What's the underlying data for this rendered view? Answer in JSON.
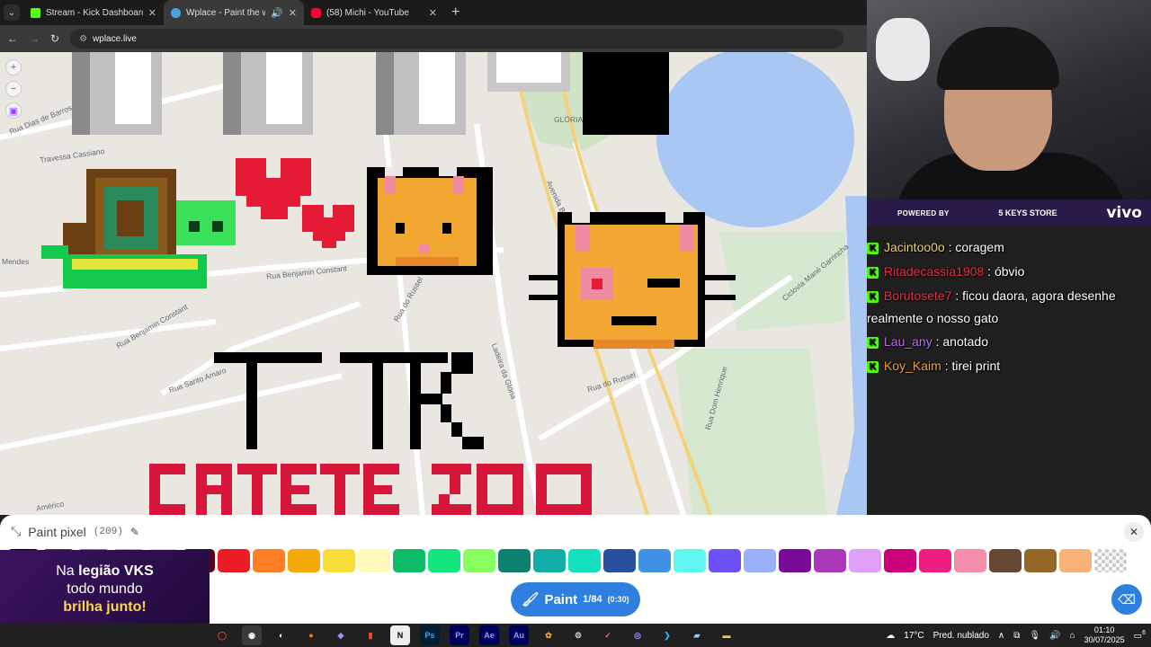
{
  "browser": {
    "tabs": [
      {
        "title": "Stream - Kick Dashboard",
        "color": "#53fc18",
        "active": false
      },
      {
        "title": "Wplace - Paint the world",
        "color": "#4aa3df",
        "active": true
      },
      {
        "title": "(58) Michi - YouTube",
        "color": "#ff0033",
        "active": false
      }
    ],
    "url": "wplace.live"
  },
  "map": {
    "streets": [
      "Rua Dias de Barros",
      "Travessa Cassiano",
      "Rua Benjamin Constant",
      "Rua Benjamin Constant",
      "Rua Santo Amaro",
      "Rua do Russel",
      "Rua do Russel",
      "Ladeira da Glória",
      "Rua Santo Amaro",
      "Avenida Beira Mar",
      "Ciclovia Mané Garrincha",
      "Rua Dom Henrique",
      "GLÓRIA",
      "Américo",
      "Mendes"
    ]
  },
  "stream": {
    "sponsor_label": "POWERED BY",
    "sponsor_logo": "5 KEYS STORE",
    "sponsor_brand": "vivo",
    "chat": [
      {
        "user": "Jacintoo0o",
        "color": "#f0d060",
        "msg": "coragem"
      },
      {
        "user": "Ritadecassia1908",
        "color": "#e8324a",
        "msg": "óbvio"
      },
      {
        "user": "Borutosete7",
        "color": "#e8324a",
        "msg": "ficou daora, agora desenhe"
      },
      {
        "user": "",
        "color": "#ffffff",
        "msg": "realmente o nosso gato"
      },
      {
        "user": "Lau_any",
        "color": "#b770f0",
        "msg": "anotado"
      },
      {
        "user": "Koy_Kaim",
        "color": "#f0a040",
        "msg": "tirei print"
      }
    ]
  },
  "panel": {
    "title": "Paint pixel",
    "count": "(209)",
    "paint_label": "Paint",
    "paint_progress": "1/84",
    "paint_timer": "(0:30)",
    "palette": [
      "#000000",
      "#3c3c3c",
      "#787878",
      "#aaaaaa",
      "#d2d2d2",
      "#600018",
      "#ed1c24",
      "#ff7f27",
      "#f6aa09",
      "#f9dd3b",
      "#fffabc",
      "#0eb968",
      "#13e67b",
      "#87ff5e",
      "#0c816e",
      "#10aea6",
      "#13e1be",
      "#28509e",
      "#4093e4",
      "#60f7f2",
      "#6b50f6",
      "#99b1fb",
      "#780c99",
      "#aa38b9",
      "#e09ff9",
      "#cb007a",
      "#ec1f80",
      "#f38da9",
      "#684634",
      "#95682a",
      "#f8b277",
      "transparent"
    ]
  },
  "promo": {
    "line1": "Na legião VKS",
    "line2": "todo mundo",
    "line3": "brilha junto!"
  },
  "taskbar": {
    "weather": "17°C",
    "weather_desc": "Pred. nublado",
    "time": "01:10",
    "date": "30/07/2025",
    "notifications": "6"
  }
}
